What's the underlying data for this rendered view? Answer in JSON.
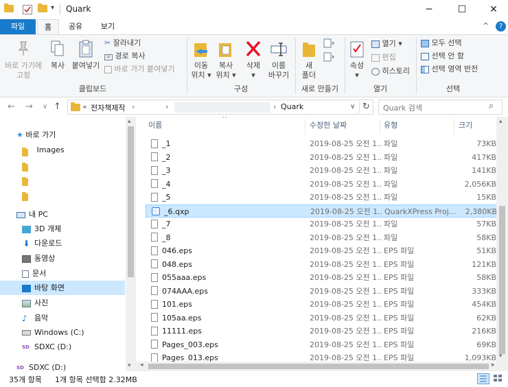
{
  "window": {
    "title": "Quark",
    "minimize": "─",
    "maximize": "☐",
    "close": "✕"
  },
  "quick_access": {
    "dropdown": "▾"
  },
  "tabs": [
    {
      "label": "파일"
    },
    {
      "label": "홈"
    },
    {
      "label": "공유"
    },
    {
      "label": "보기"
    }
  ],
  "ribbon": {
    "clipboard": {
      "pin": "바로 가기에\n고정",
      "pin_l1": "바로 가기에",
      "pin_l2": "고정",
      "copy": "복사",
      "paste": "붙여넣기",
      "cut": "잘라내기",
      "copy_path": "경로 복사",
      "paste_shortcut": "바로 가기 붙여넣기",
      "group": "클립보드"
    },
    "organize": {
      "move_l1": "이동",
      "move_l2": "위치 ▾",
      "copy_l1": "복사",
      "copy_l2": "위치 ▾",
      "delete_l1": "삭제",
      "delete_l2": "▾",
      "rename_l1": "이름",
      "rename_l2": "바꾸기",
      "group": "구성"
    },
    "new": {
      "folder_l1": "새",
      "folder_l2": "폴더",
      "group": "새로 만들기"
    },
    "open": {
      "properties_l1": "속성",
      "properties_l2": "▾",
      "open": "열기 ▾",
      "edit": "편집",
      "history": "히스토리",
      "group": "열기"
    },
    "select": {
      "all": "모두 선택",
      "none": "선택 안 함",
      "invert": "선택 영역 반전",
      "group": "선택"
    },
    "collapse": "^",
    "help": "?"
  },
  "address": {
    "back": "←",
    "forward": "→",
    "recent": "∨",
    "up": "↑",
    "overflow": "«",
    "crumb1": "전자책제작",
    "crumb_sep": "›",
    "crumb_last": "Quark",
    "dropdown": "∨",
    "refresh": "↻",
    "search_placeholder": "Quark 검색",
    "search_icon": "⌕"
  },
  "nav": {
    "quick_access": "바로 가기",
    "images": "Images",
    "this_pc": "내 PC",
    "objects3d": "3D 개체",
    "downloads": "다운로드",
    "videos": "동영상",
    "documents": "문서",
    "desktop": "바탕 화면",
    "pictures": "사진",
    "music": "음악",
    "windows_c": "Windows (C:)",
    "sdxc_d": "SDXC (D:)",
    "sdxc_d2": "SDXC (D:)",
    "scroll_up": "▴",
    "scroll_down": "▾"
  },
  "columns": {
    "name": "이름",
    "modified": "수정한 날짜",
    "type": "유형",
    "size": "크기",
    "sort": "^"
  },
  "files": [
    {
      "name": "_1",
      "modified": "2019-08-25 오전 1...",
      "type": "파일",
      "size": "73KB"
    },
    {
      "name": "_2",
      "modified": "2019-08-25 오전 1...",
      "type": "파일",
      "size": "417KB"
    },
    {
      "name": "_3",
      "modified": "2019-08-25 오전 1...",
      "type": "파일",
      "size": "141KB"
    },
    {
      "name": "_4",
      "modified": "2019-08-25 오전 1...",
      "type": "파일",
      "size": "2,056KB"
    },
    {
      "name": "_5",
      "modified": "2019-08-25 오전 1...",
      "type": "파일",
      "size": "15KB"
    },
    {
      "name": "_6.qxp",
      "modified": "2019-08-25 오전 1...",
      "type": "QuarkXPress Proj...",
      "size": "2,380KB"
    },
    {
      "name": "_7",
      "modified": "2019-08-25 오전 1...",
      "type": "파일",
      "size": "57KB"
    },
    {
      "name": "_8",
      "modified": "2019-08-25 오전 1...",
      "type": "파일",
      "size": "58KB"
    },
    {
      "name": "046.eps",
      "modified": "2019-08-25 오전 1...",
      "type": "EPS 파일",
      "size": "51KB"
    },
    {
      "name": "048.eps",
      "modified": "2019-08-25 오전 1...",
      "type": "EPS 파일",
      "size": "121KB"
    },
    {
      "name": "055aaa.eps",
      "modified": "2019-08-25 오전 1...",
      "type": "EPS 파일",
      "size": "58KB"
    },
    {
      "name": "074AAA.eps",
      "modified": "2019-08-25 오전 1...",
      "type": "EPS 파일",
      "size": "333KB"
    },
    {
      "name": "101.eps",
      "modified": "2019-08-25 오전 1...",
      "type": "EPS 파일",
      "size": "454KB"
    },
    {
      "name": "105aa.eps",
      "modified": "2019-08-25 오전 1...",
      "type": "EPS 파일",
      "size": "62KB"
    },
    {
      "name": "11111.eps",
      "modified": "2019-08-25 오전 1...",
      "type": "EPS 파일",
      "size": "216KB"
    },
    {
      "name": "Pages_003.eps",
      "modified": "2019-08-25 오전 1...",
      "type": "EPS 파일",
      "size": "69KB"
    },
    {
      "name": "Pages_013.eps",
      "modified": "2019-08-25 오전 1...",
      "type": "EPS 파일",
      "size": "1,093KB"
    }
  ],
  "scroll": {
    "up": "▴",
    "down": "▾",
    "left": "◂",
    "right": "▸"
  },
  "status": {
    "count": "35개 항목",
    "selection": "1개 항목 선택함 2.32MB"
  },
  "colors": {
    "accent": "#1979ca",
    "selection": "#cce8ff",
    "folder": "#e8b738",
    "delete_red": "#e81123"
  },
  "icons": [
    "folder-icon",
    "checkbox-icon",
    "pin-icon",
    "copy-icon",
    "paste-icon",
    "scissors-icon",
    "delete-icon",
    "rename-icon",
    "properties-icon",
    "star-icon",
    "pc-icon",
    "download-icon",
    "video-icon",
    "document-icon",
    "desktop-icon",
    "pictures-icon",
    "music-icon",
    "drive-icon",
    "sd-icon",
    "file-icon",
    "qxp-file-icon"
  ]
}
